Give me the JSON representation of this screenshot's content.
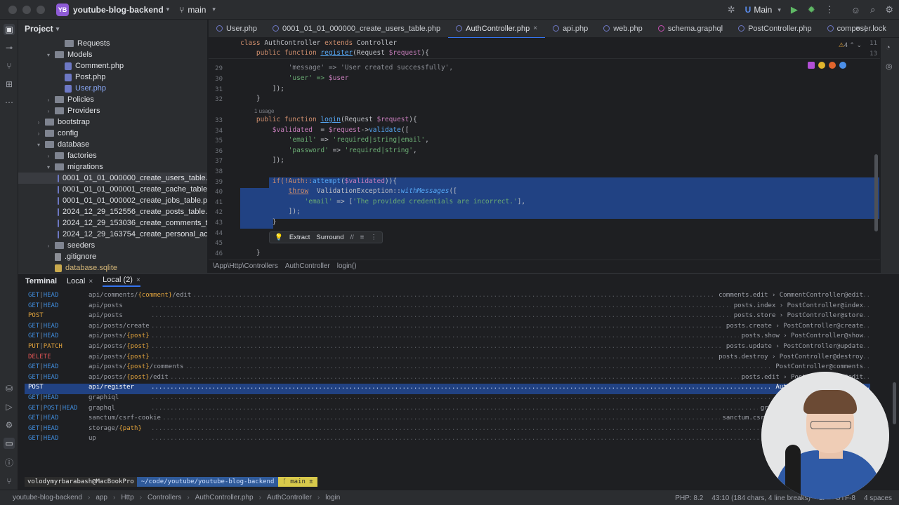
{
  "topbar": {
    "project_badge": "YB",
    "project_name": "youtube-blog-backend",
    "branch": "main",
    "run_config": "Main"
  },
  "project_panel": {
    "title": "Project",
    "items": [
      {
        "label": "Requests",
        "kind": "folder"
      },
      {
        "label": "Models",
        "kind": "folder"
      },
      {
        "label": "Comment.php",
        "kind": "php"
      },
      {
        "label": "Post.php",
        "kind": "php"
      },
      {
        "label": "User.php",
        "kind": "php"
      },
      {
        "label": "Policies",
        "kind": "folder"
      },
      {
        "label": "Providers",
        "kind": "folder"
      },
      {
        "label": "bootstrap",
        "kind": "folder"
      },
      {
        "label": "config",
        "kind": "folder"
      },
      {
        "label": "database",
        "kind": "folder"
      },
      {
        "label": "factories",
        "kind": "folder"
      },
      {
        "label": "migrations",
        "kind": "folder"
      },
      {
        "label": "0001_01_01_000000_create_users_table.php",
        "kind": "migration"
      },
      {
        "label": "0001_01_01_000001_create_cache_table.php",
        "kind": "migration"
      },
      {
        "label": "0001_01_01_000002_create_jobs_table.php",
        "kind": "migration"
      },
      {
        "label": "2024_12_29_152556_create_posts_table.php",
        "kind": "migration"
      },
      {
        "label": "2024_12_29_153036_create_comments_table.ph",
        "kind": "migration"
      },
      {
        "label": "2024_12_29_163754_create_personal_access_to",
        "kind": "migration"
      },
      {
        "label": "seeders",
        "kind": "folder"
      },
      {
        "label": ".gitignore",
        "kind": "text"
      },
      {
        "label": "database.sqlite",
        "kind": "db"
      }
    ]
  },
  "tabs": [
    {
      "label": "User.php"
    },
    {
      "label": "0001_01_01_000000_create_users_table.php"
    },
    {
      "label": "AuthController.php",
      "active": true
    },
    {
      "label": "api.php"
    },
    {
      "label": "web.php"
    },
    {
      "label": "schema.graphql"
    },
    {
      "label": "PostController.php"
    },
    {
      "label": "composer.lock"
    }
  ],
  "editor": {
    "inspection_count": "4",
    "usage_hint": "1 usage",
    "lines": {
      "l11": "11",
      "l13": "13",
      "l29": "29",
      "l30": "30",
      "l31": "31",
      "l32": "32",
      "l33": "33",
      "l34": "34",
      "l35": "35",
      "l36": "36",
      "l37": "37",
      "l38": "38",
      "l39": "39",
      "l40": "40",
      "l41": "41",
      "l42": "42",
      "l43": "43",
      "l44": "44",
      "l45": "45",
      "l46": "46"
    },
    "code": {
      "c11a": "class ",
      "c11b": "AuthController ",
      "c11c": "extends ",
      "c11d": "Controller",
      "c13a": "    public function ",
      "c13b": "register",
      "c13c": "(Request ",
      "c13d": "$request",
      "c13e": "){",
      "c29a": "            'message' => 'User created successfully',",
      "c30a": "            'user' => ",
      "c30b": "$user",
      "c31": "        ]);",
      "c32": "    }",
      "c33a": "    public function ",
      "c33b": "login",
      "c33c": "(Request ",
      "c33d": "$request",
      "c33e": "){",
      "c34a": "        ",
      "c34b": "$validated",
      "c34c": "  = ",
      "c34d": "$request",
      "c34e": "->",
      "c34f": "validate",
      "c34g": "([",
      "c35a": "            ",
      "c35b": "'email'",
      "c35c": " => ",
      "c35d": "'required|string|email'",
      "c35e": ",",
      "c36a": "            ",
      "c36b": "'password'",
      "c36c": " => ",
      "c36d": "'required|string'",
      "c36e": ",",
      "c37": "        ]);",
      "c39a": "        if(!Auth::",
      "c39b": "attempt",
      "c39c": "(",
      "c39d": "$validated",
      "c39e": ")){",
      "c40a": "            ",
      "c40b": "throw",
      "c40c": "  ValidationException::",
      "c40d": "withMessages",
      "c40e": "([",
      "c41a": "                ",
      "c41b": "'email'",
      "c41c": " => [",
      "c41d": "'The provided credentials are incorrect.'",
      "c41e": "],",
      "c42": "            ]);",
      "c43": "        }",
      "c46": "    }"
    },
    "popup": {
      "extract": "Extract",
      "surround": "Surround"
    }
  },
  "editor_breadcrumb": [
    "\\App\\Http\\Controllers",
    "AuthController",
    "login()"
  ],
  "terminal": {
    "tabs": [
      "Terminal",
      "Local",
      "Local (2)"
    ],
    "routes": [
      {
        "method": [
          "GET",
          "HEAD"
        ],
        "uri": "api/comments/",
        "param": "{comment}",
        "suffix": "/edit",
        "name": "comments.edit › CommentController@edit"
      },
      {
        "method": [
          "GET",
          "HEAD"
        ],
        "uri": "api/posts",
        "param": "",
        "suffix": "",
        "name": "posts.index › PostController@index"
      },
      {
        "method": [
          "POST"
        ],
        "uri": "api/posts",
        "param": "",
        "suffix": "",
        "name": "posts.store › PostController@store"
      },
      {
        "method": [
          "GET",
          "HEAD"
        ],
        "uri": "api/posts/create",
        "param": "",
        "suffix": "",
        "name": "posts.create › PostController@create"
      },
      {
        "method": [
          "GET",
          "HEAD"
        ],
        "uri": "api/posts/",
        "param": "{post}",
        "suffix": "",
        "name": "posts.show › PostController@show"
      },
      {
        "method": [
          "PUT",
          "PATCH"
        ],
        "uri": "api/posts/",
        "param": "{post}",
        "suffix": "",
        "name": "posts.update › PostController@update"
      },
      {
        "method": [
          "DELETE"
        ],
        "uri": "api/posts/",
        "param": "{post}",
        "suffix": "",
        "name": "posts.destroy › PostController@destroy"
      },
      {
        "method": [
          "GET",
          "HEAD"
        ],
        "uri": "api/posts/",
        "param": "{post}",
        "suffix": "/comments",
        "name": "PostController@comments"
      },
      {
        "method": [
          "GET",
          "HEAD"
        ],
        "uri": "api/posts/",
        "param": "{post}",
        "suffix": "/edit",
        "name": "posts.edit › PostController@edit"
      },
      {
        "method": [
          "POST"
        ],
        "uri": "api/register",
        "param": "",
        "suffix": "",
        "name": "AuthController@register",
        "highlight": true
      },
      {
        "method": [
          "GET",
          "HEAD"
        ],
        "uri": "graphiql",
        "param": "",
        "suffix": "",
        "name": "graphiql › MLL\\GraphiQL"
      },
      {
        "method": [
          "GET",
          "POST",
          "HEAD"
        ],
        "uri": "graphql",
        "param": "",
        "suffix": "",
        "name": "graphql › Nuwave\\Lighthouse"
      },
      {
        "method": [
          "GET",
          "HEAD"
        ],
        "uri": "sanctum/csrf-cookie",
        "param": "",
        "suffix": "",
        "name": "sanctum.csrf-cookie › Laravel\\Sanctum"
      },
      {
        "method": [
          "GET",
          "HEAD"
        ],
        "uri": "storage/",
        "param": "{path}",
        "suffix": "",
        "name": ""
      },
      {
        "method": [
          "GET",
          "HEAD"
        ],
        "uri": "up",
        "param": "",
        "suffix": "",
        "name": ""
      }
    ],
    "prompt": {
      "user": "volodymyrbarabash@MacBookPro",
      "path": "~/code/youtube/youtube-blog-backend",
      "branch": "ᚴ main ±"
    }
  },
  "status": {
    "crumbs": [
      "youtube-blog-backend",
      "app",
      "Http",
      "Controllers",
      "AuthController.php",
      "AuthController",
      "login"
    ],
    "php": "PHP: 8.2",
    "position": "43:10 (184 chars, 4 line breaks)",
    "line_sep": "LF",
    "encoding": "UTF-8",
    "indent": "4 spaces"
  }
}
